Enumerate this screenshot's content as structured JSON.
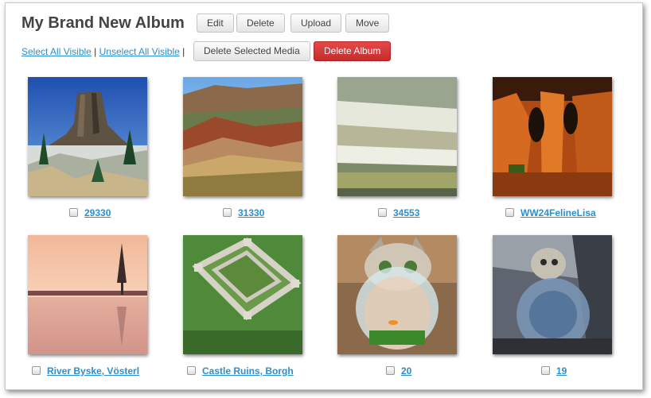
{
  "album": {
    "title": "My Brand New Album",
    "edit_label": "Edit",
    "delete_label": "Delete",
    "upload_label": "Upload",
    "move_label": "Move"
  },
  "selection": {
    "select_all_label": "Select All Visible",
    "unselect_all_label": "Unselect All Visible",
    "separator": "|",
    "delete_selected_label": "Delete Selected Media",
    "delete_album_label": "Delete Album"
  },
  "media": [
    {
      "caption": "29330",
      "thumbnail": "butte-rock-tower-photo"
    },
    {
      "caption": "31330",
      "thumbnail": "painted-hills-photo"
    },
    {
      "caption": "34553",
      "thumbnail": "white-terraces-photo"
    },
    {
      "caption": "WW24FelineLisa",
      "thumbnail": "red-rock-canyon-photo"
    },
    {
      "caption": "River Byske, Vösterl",
      "thumbnail": "misty-sunset-lake-photo"
    },
    {
      "caption": "Castle Ruins, Borgh",
      "thumbnail": "castle-ruins-aerial-photo"
    },
    {
      "caption": "20",
      "thumbnail": "cat-fishbowl-photo"
    },
    {
      "caption": "19",
      "thumbnail": "fishbowl-abstract-photo"
    }
  ],
  "colors": {
    "link": "#2a8fd0",
    "danger": "#c42d2d"
  }
}
